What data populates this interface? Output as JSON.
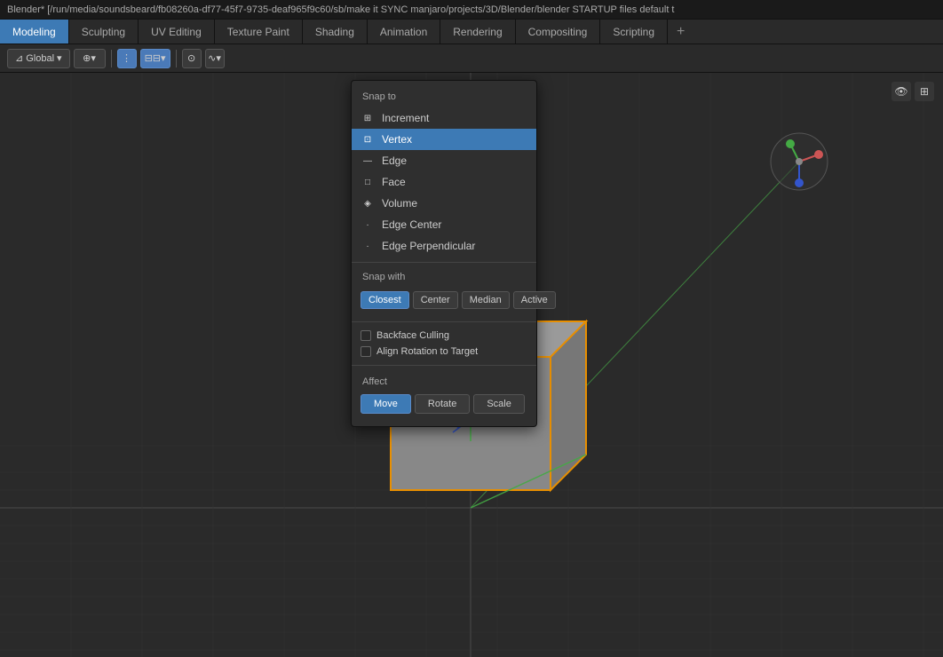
{
  "titlebar": {
    "text": "Blender* [/run/media/soundsbeard/fb08260a-df77-45f7-9735-deaf965f9c60/sb/make it SYNC manjaro/projects/3D/Blender/blender STARTUP files default t"
  },
  "tabs": [
    {
      "id": "modeling",
      "label": "Modeling",
      "active": true
    },
    {
      "id": "sculpting",
      "label": "Sculpting",
      "active": false
    },
    {
      "id": "uv-editing",
      "label": "UV Editing",
      "active": false
    },
    {
      "id": "texture-paint",
      "label": "Texture Paint",
      "active": false
    },
    {
      "id": "shading",
      "label": "Shading",
      "active": false
    },
    {
      "id": "animation",
      "label": "Animation",
      "active": false
    },
    {
      "id": "rendering",
      "label": "Rendering",
      "active": false
    },
    {
      "id": "compositing",
      "label": "Compositing",
      "active": false
    },
    {
      "id": "scripting",
      "label": "Scripting",
      "active": false
    }
  ],
  "toolbar": {
    "global_label": "Global",
    "proportional_icon": "⊙",
    "snap_icon": "⋮",
    "snap_active": true
  },
  "snap_panel": {
    "snap_to_label": "Snap to",
    "items": [
      {
        "id": "increment",
        "label": "Increment",
        "icon": "⊞",
        "selected": false
      },
      {
        "id": "vertex",
        "label": "Vertex",
        "icon": "⊡",
        "selected": true
      },
      {
        "id": "edge",
        "label": "Edge",
        "icon": "—",
        "selected": false
      },
      {
        "id": "face",
        "label": "Face",
        "icon": "□",
        "selected": false
      },
      {
        "id": "volume",
        "label": "Volume",
        "icon": "◈",
        "selected": false
      },
      {
        "id": "edge-center",
        "label": "Edge Center",
        "icon": "·",
        "selected": false
      },
      {
        "id": "edge-perpendicular",
        "label": "Edge Perpendicular",
        "icon": "·",
        "selected": false
      }
    ],
    "snap_with_label": "Snap with",
    "snap_with_buttons": [
      {
        "id": "closest",
        "label": "Closest",
        "active": true
      },
      {
        "id": "center",
        "label": "Center",
        "active": false
      },
      {
        "id": "median",
        "label": "Median",
        "active": false
      },
      {
        "id": "active",
        "label": "Active",
        "active": false
      }
    ],
    "checkboxes": [
      {
        "id": "backface-culling",
        "label": "Backface Culling",
        "checked": false
      },
      {
        "id": "align-rotation",
        "label": "Align Rotation to Target",
        "checked": false
      }
    ],
    "affect_label": "Affect",
    "affect_buttons": [
      {
        "id": "move",
        "label": "Move",
        "active": true
      },
      {
        "id": "rotate",
        "label": "Rotate",
        "active": false
      },
      {
        "id": "scale",
        "label": "Scale",
        "active": false
      }
    ]
  },
  "colors": {
    "accent_blue": "#3d7ab5",
    "grid_dark": "#2a2a2a",
    "cube_fill": "#8a8a8a",
    "cube_outline": "#e88f00",
    "axis_red": "#cc3333",
    "axis_green": "#44aa44",
    "axis_blue": "#3355cc"
  }
}
